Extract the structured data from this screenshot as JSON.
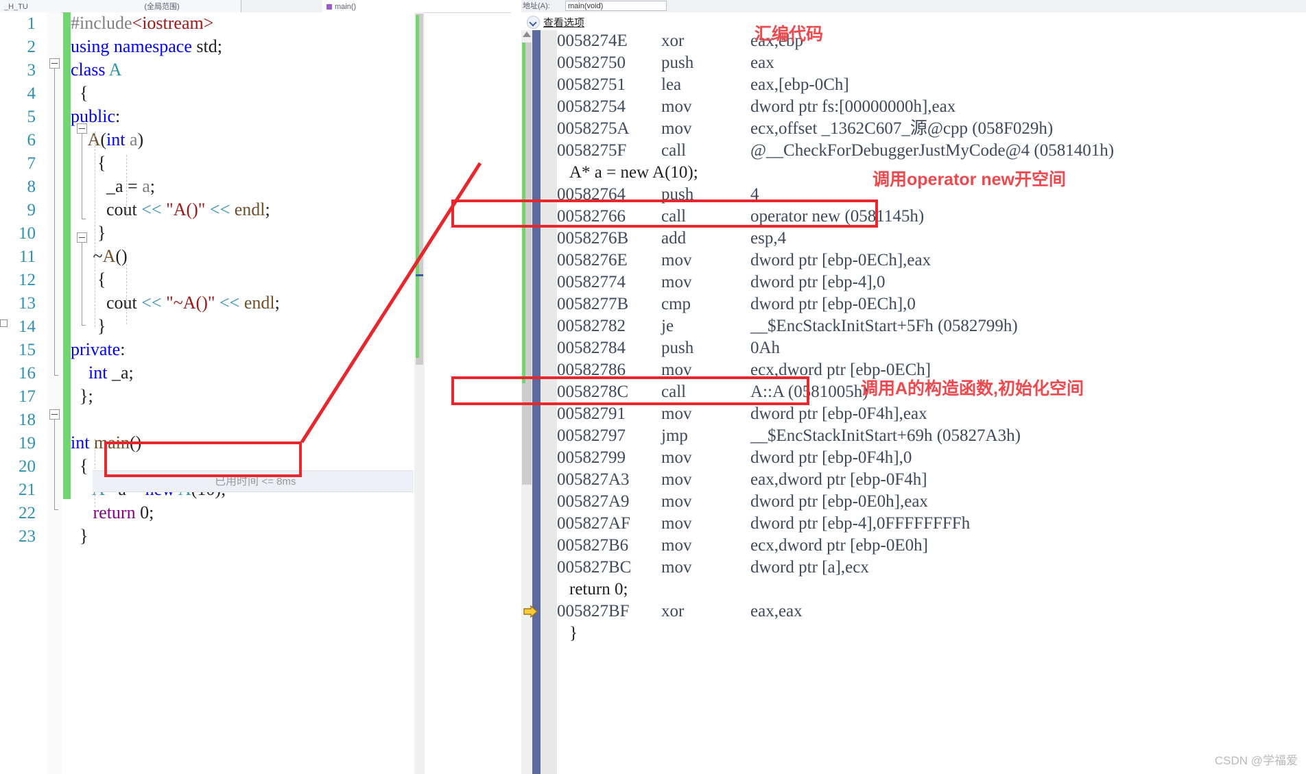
{
  "editor": {
    "tab_left_label": "_H_TU",
    "tab_mid_label": "(全局范围)",
    "tab_right_label": "main()",
    "elapsed_label": "已用时间",
    "elapsed_value": "<= 8ms",
    "line_numbers": [
      "1",
      "2",
      "3",
      "4",
      "5",
      "6",
      "7",
      "8",
      "9",
      "10",
      "11",
      "12",
      "13",
      "14",
      "15",
      "16",
      "17",
      "18",
      "19",
      "20",
      "21",
      "22",
      "23"
    ],
    "code_lines": [
      {
        "n": 1,
        "tokens": [
          {
            "t": "#include",
            "c": "pre"
          },
          {
            "t": "<iostream>",
            "c": "str"
          }
        ]
      },
      {
        "n": 2,
        "tokens": [
          {
            "t": "using namespace ",
            "c": "kw"
          },
          {
            "t": "std;",
            "c": "plain"
          }
        ]
      },
      {
        "n": 3,
        "tokens": [
          {
            "t": "class ",
            "c": "kw"
          },
          {
            "t": "A",
            "c": "type"
          }
        ]
      },
      {
        "n": 4,
        "tokens": [
          {
            "t": "  {",
            "c": "plain"
          }
        ]
      },
      {
        "n": 5,
        "tokens": [
          {
            "t": "public",
            "c": "kw"
          },
          {
            "t": ":",
            "c": "plain"
          }
        ]
      },
      {
        "n": 6,
        "tokens": [
          {
            "t": "    ",
            "c": "plain"
          },
          {
            "t": "A",
            "c": "func"
          },
          {
            "t": "(",
            "c": "plain"
          },
          {
            "t": "int",
            "c": "kw"
          },
          {
            "t": " ",
            "c": "plain"
          },
          {
            "t": "a",
            "c": "param"
          },
          {
            "t": ")",
            "c": "plain"
          }
        ]
      },
      {
        "n": 7,
        "tokens": [
          {
            "t": "      {",
            "c": "plain"
          }
        ]
      },
      {
        "n": 8,
        "tokens": [
          {
            "t": "        _a = ",
            "c": "plain"
          },
          {
            "t": "a",
            "c": "param"
          },
          {
            "t": ";",
            "c": "plain"
          }
        ]
      },
      {
        "n": 9,
        "tokens": [
          {
            "t": "        cout ",
            "c": "plain"
          },
          {
            "t": "<<",
            "c": "op"
          },
          {
            "t": " ",
            "c": "plain"
          },
          {
            "t": "\"A()\"",
            "c": "str"
          },
          {
            "t": " ",
            "c": "plain"
          },
          {
            "t": "<<",
            "c": "op"
          },
          {
            "t": " ",
            "c": "plain"
          },
          {
            "t": "endl",
            "c": "func"
          },
          {
            "t": ";",
            "c": "plain"
          }
        ]
      },
      {
        "n": 10,
        "tokens": [
          {
            "t": "      }",
            "c": "plain"
          }
        ]
      },
      {
        "n": 11,
        "tokens": [
          {
            "t": "     ~",
            "c": "plain"
          },
          {
            "t": "A",
            "c": "func"
          },
          {
            "t": "()",
            "c": "plain"
          }
        ]
      },
      {
        "n": 12,
        "tokens": [
          {
            "t": "      {",
            "c": "plain"
          }
        ]
      },
      {
        "n": 13,
        "tokens": [
          {
            "t": "        cout ",
            "c": "plain"
          },
          {
            "t": "<<",
            "c": "op"
          },
          {
            "t": " ",
            "c": "plain"
          },
          {
            "t": "\"~A()\"",
            "c": "str"
          },
          {
            "t": " ",
            "c": "plain"
          },
          {
            "t": "<<",
            "c": "op"
          },
          {
            "t": " ",
            "c": "plain"
          },
          {
            "t": "endl",
            "c": "func"
          },
          {
            "t": ";",
            "c": "plain"
          }
        ]
      },
      {
        "n": 14,
        "tokens": [
          {
            "t": "      }",
            "c": "plain"
          }
        ]
      },
      {
        "n": 15,
        "tokens": [
          {
            "t": "private",
            "c": "kw"
          },
          {
            "t": ":",
            "c": "plain"
          }
        ]
      },
      {
        "n": 16,
        "tokens": [
          {
            "t": "    ",
            "c": "plain"
          },
          {
            "t": "int",
            "c": "kw"
          },
          {
            "t": " _a;",
            "c": "plain"
          }
        ]
      },
      {
        "n": 17,
        "tokens": [
          {
            "t": "  };",
            "c": "plain"
          }
        ]
      },
      {
        "n": 18,
        "tokens": [
          {
            "t": "",
            "c": "plain"
          }
        ]
      },
      {
        "n": 19,
        "tokens": [
          {
            "t": "int",
            "c": "kw"
          },
          {
            "t": " ",
            "c": "plain"
          },
          {
            "t": "main",
            "c": "func"
          },
          {
            "t": "()",
            "c": "plain"
          }
        ]
      },
      {
        "n": 20,
        "tokens": [
          {
            "t": "  {",
            "c": "plain"
          }
        ]
      },
      {
        "n": 21,
        "tokens": [
          {
            "t": "     ",
            "c": "plain"
          },
          {
            "t": "A",
            "c": "type"
          },
          {
            "t": "* a = ",
            "c": "plain"
          },
          {
            "t": "new",
            "c": "kw"
          },
          {
            "t": " ",
            "c": "plain"
          },
          {
            "t": "A",
            "c": "type"
          },
          {
            "t": "(10);",
            "c": "plain"
          }
        ]
      },
      {
        "n": 22,
        "tokens": [
          {
            "t": "     ",
            "c": "plain"
          },
          {
            "t": "return",
            "c": "purple"
          },
          {
            "t": " 0;",
            "c": "plain"
          }
        ]
      },
      {
        "n": 23,
        "tokens": [
          {
            "t": "  }",
            "c": "plain"
          }
        ]
      }
    ]
  },
  "disasm": {
    "address_label": "地址(A):",
    "address_value": "main(void)",
    "view_options_label": "查看选项",
    "rows": [
      {
        "kind": "asm",
        "addr": "0058274E",
        "mnem": "xor",
        "ops": "eax,ebp"
      },
      {
        "kind": "asm",
        "addr": "00582750",
        "mnem": "push",
        "ops": "eax"
      },
      {
        "kind": "asm",
        "addr": "00582751",
        "mnem": "lea",
        "ops": "eax,[ebp-0Ch]"
      },
      {
        "kind": "asm",
        "addr": "00582754",
        "mnem": "mov",
        "ops": "dword ptr fs:[00000000h],eax"
      },
      {
        "kind": "asm",
        "addr": "0058275A",
        "mnem": "mov",
        "ops": "ecx,offset _1362C607_源@cpp (058F029h)"
      },
      {
        "kind": "asm",
        "addr": "0058275F",
        "mnem": "call",
        "ops": "@__CheckForDebuggerJustMyCode@4 (0581401h)"
      },
      {
        "kind": "src",
        "text": "A* a = new A(10);"
      },
      {
        "kind": "asm",
        "addr": "00582764",
        "mnem": "push",
        "ops": "4"
      },
      {
        "kind": "asm",
        "addr": "00582766",
        "mnem": "call",
        "ops": "operator new (0581145h)"
      },
      {
        "kind": "asm",
        "addr": "0058276B",
        "mnem": "add",
        "ops": "esp,4"
      },
      {
        "kind": "asm",
        "addr": "0058276E",
        "mnem": "mov",
        "ops": "dword ptr [ebp-0ECh],eax"
      },
      {
        "kind": "asm",
        "addr": "00582774",
        "mnem": "mov",
        "ops": "dword ptr [ebp-4],0"
      },
      {
        "kind": "asm",
        "addr": "0058277B",
        "mnem": "cmp",
        "ops": "dword ptr [ebp-0ECh],0"
      },
      {
        "kind": "asm",
        "addr": "00582782",
        "mnem": "je",
        "ops": "__$EncStackInitStart+5Fh (0582799h)"
      },
      {
        "kind": "asm",
        "addr": "00582784",
        "mnem": "push",
        "ops": "0Ah"
      },
      {
        "kind": "asm",
        "addr": "00582786",
        "mnem": "mov",
        "ops": "ecx,dword ptr [ebp-0ECh]"
      },
      {
        "kind": "asm",
        "addr": "0058278C",
        "mnem": "call",
        "ops": "A::A (0581005h)"
      },
      {
        "kind": "asm",
        "addr": "00582791",
        "mnem": "mov",
        "ops": "dword ptr [ebp-0F4h],eax"
      },
      {
        "kind": "asm",
        "addr": "00582797",
        "mnem": "jmp",
        "ops": "__$EncStackInitStart+69h (05827A3h)"
      },
      {
        "kind": "asm",
        "addr": "00582799",
        "mnem": "mov",
        "ops": "dword ptr [ebp-0F4h],0"
      },
      {
        "kind": "asm",
        "addr": "005827A3",
        "mnem": "mov",
        "ops": "eax,dword ptr [ebp-0F4h]"
      },
      {
        "kind": "asm",
        "addr": "005827A9",
        "mnem": "mov",
        "ops": "dword ptr [ebp-0E0h],eax"
      },
      {
        "kind": "asm",
        "addr": "005827AF",
        "mnem": "mov",
        "ops": "dword ptr [ebp-4],0FFFFFFFFh"
      },
      {
        "kind": "asm",
        "addr": "005827B6",
        "mnem": "mov",
        "ops": "ecx,dword ptr [ebp-0E0h]"
      },
      {
        "kind": "asm",
        "addr": "005827BC",
        "mnem": "mov",
        "ops": "dword ptr [a],ecx"
      },
      {
        "kind": "src",
        "text": "return 0;"
      },
      {
        "kind": "asm",
        "addr": "005827BF",
        "mnem": "xor",
        "ops": "eax,eax",
        "current": true
      },
      {
        "kind": "src",
        "text": "}"
      }
    ]
  },
  "annotations": {
    "assembly_code": "汇编代码",
    "operator_new": "调用operator new开空间",
    "constructor": "调用A的构造函数,初始化空间"
  },
  "watermark": "CSDN @学福爱",
  "colors": {
    "annotation_red": "#f0484c",
    "box_red": "#e8262b",
    "changebar_green": "#72d572",
    "type_blue": "#2b91af",
    "keyword_blue": "#0000ff",
    "string_red": "#a31515"
  }
}
